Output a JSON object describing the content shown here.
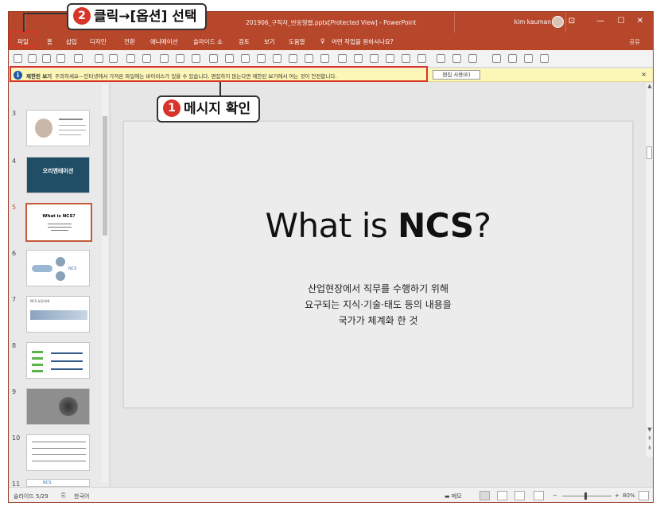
{
  "window": {
    "title": "201906_구직자_반응형웹.pptx[Protected View] - PowerPoint",
    "user": "kim kauman",
    "controls": [
      "⊡",
      "—",
      "☐",
      "✕"
    ]
  },
  "ribbon": {
    "tabs": [
      "파일",
      "홈",
      "삽입",
      "디자인",
      "전환",
      "애니메이션",
      "슬라이드 쇼",
      "검토",
      "보기",
      "도움말",
      "어떤 작업을 원하시나요?"
    ],
    "share": "공유"
  },
  "message_bar": {
    "label": "제한된 보기",
    "text": "주의하세요—인터넷에서 가져온 파일에는 바이러스가 있을 수 있습니다. 편집하지 않는다면 제한된 보기에서 여는 것이 안전합니다.",
    "button": "편집 사용(E)",
    "close": "×"
  },
  "thumbnails": [
    {
      "num": "3",
      "caption": ""
    },
    {
      "num": "4",
      "caption": "오리엔테이션"
    },
    {
      "num": "5",
      "caption": "What is NCS?"
    },
    {
      "num": "6",
      "caption": "NCS"
    },
    {
      "num": "7",
      "caption": "NCS 분류체계"
    },
    {
      "num": "8",
      "caption": ""
    },
    {
      "num": "9",
      "caption": ""
    },
    {
      "num": "10",
      "caption": ""
    },
    {
      "num": "11",
      "caption": "NCS"
    }
  ],
  "slide": {
    "title_plain": "What is ",
    "title_bold": "NCS",
    "title_end": "?",
    "body": [
      "산업현장에서 직무를 수행하기 위해",
      "요구되는 지식·기술·태도 등의 내용을",
      "국가가 체계화 한 것"
    ]
  },
  "status": {
    "slide_info": "슬라이드 5/29",
    "language": "한국어",
    "notes": "메모",
    "zoom": "80%"
  },
  "callouts": {
    "step1": {
      "num": "1",
      "text": "메시지 확인"
    },
    "step2": {
      "num": "2",
      "text": "클릭→[옵션] 선택"
    }
  },
  "colors": {
    "ribbon": "#b7472a",
    "highlight": "#d9342a",
    "message_bar": "#fcf7b6"
  }
}
